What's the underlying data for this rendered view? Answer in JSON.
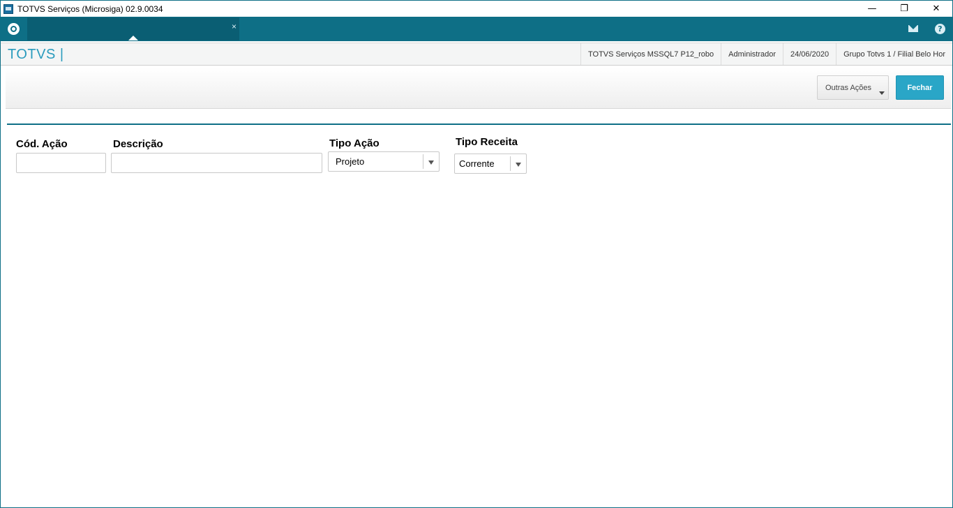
{
  "window": {
    "title": "TOTVS Serviços (Microsiga) 02.9.0034",
    "controls": {
      "minimize": "—",
      "restore": "❐",
      "close": "✕"
    }
  },
  "topbar": {
    "tab_close": "×",
    "help_glyph": "?"
  },
  "header": {
    "brand": "TOTVS |",
    "server": "TOTVS Serviços MSSQL7 P12_robo",
    "user": "Administrador",
    "date": "24/06/2020",
    "company": "Grupo Totvs 1 / Filial Belo Hor"
  },
  "actions": {
    "outras_label": "Outras Ações",
    "fechar_label": "Fechar"
  },
  "form": {
    "cod_acao": {
      "label": "Cód. Ação",
      "value": ""
    },
    "descricao": {
      "label": "Descrição",
      "value": ""
    },
    "tipo_acao": {
      "label": "Tipo Ação",
      "selected": "Projeto"
    },
    "tipo_receita": {
      "label": "Tipo Receita",
      "selected": "Corrente"
    }
  },
  "colors": {
    "accent": "#0e6f86",
    "brand": "#2a9bbd",
    "primary_button": "#2aa6c7"
  }
}
